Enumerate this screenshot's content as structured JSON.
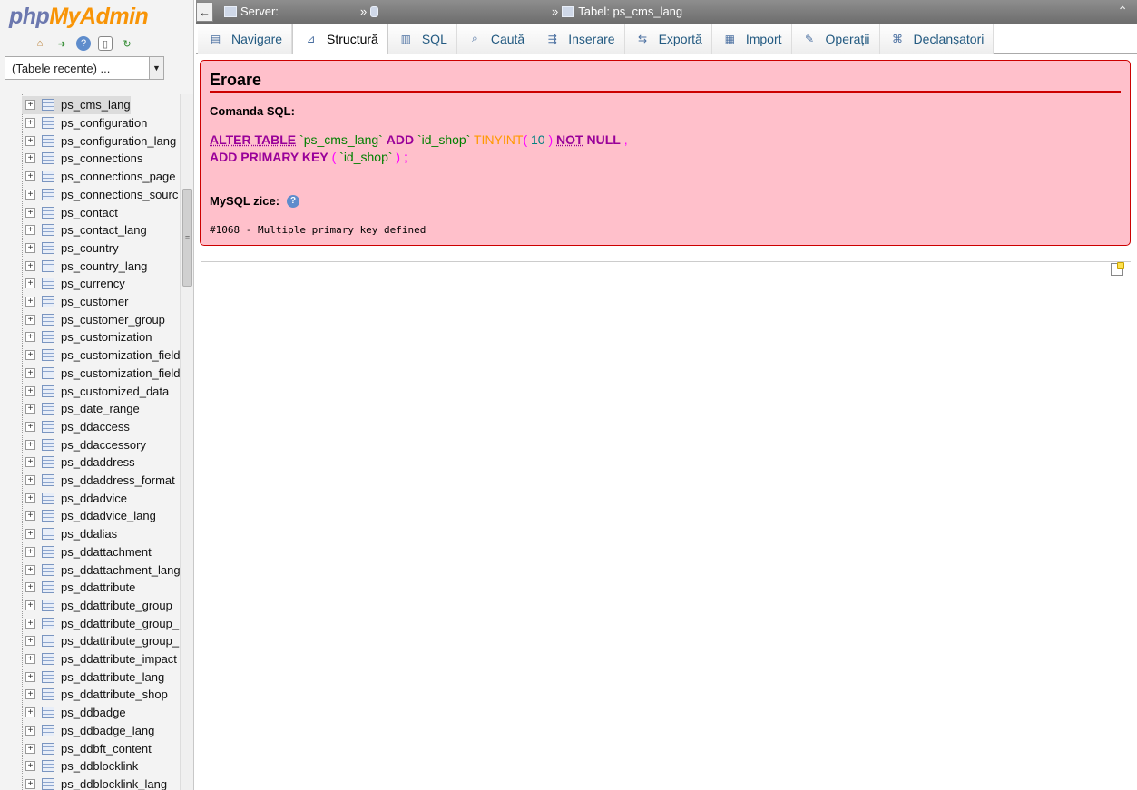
{
  "logo": {
    "php": "php",
    "myadmin": "MyAdmin"
  },
  "nav_icons": [
    "home-icon",
    "logout-icon",
    "help-icon",
    "docs-icon",
    "reload-icon"
  ],
  "recent_tables": {
    "value": "(Tabele recente) ..."
  },
  "tree": {
    "items": [
      "ps_cms_lang",
      "ps_configuration",
      "ps_configuration_lang",
      "ps_connections",
      "ps_connections_page",
      "ps_connections_sourc",
      "ps_contact",
      "ps_contact_lang",
      "ps_country",
      "ps_country_lang",
      "ps_currency",
      "ps_customer",
      "ps_customer_group",
      "ps_customization",
      "ps_customization_field",
      "ps_customization_field",
      "ps_customized_data",
      "ps_date_range",
      "ps_ddaccess",
      "ps_ddaccessory",
      "ps_ddaddress",
      "ps_ddaddress_format",
      "ps_ddadvice",
      "ps_ddadvice_lang",
      "ps_ddalias",
      "ps_ddattachment",
      "ps_ddattachment_lang",
      "ps_ddattribute",
      "ps_ddattribute_group",
      "ps_ddattribute_group_",
      "ps_ddattribute_group_",
      "ps_ddattribute_impact",
      "ps_ddattribute_lang",
      "ps_ddattribute_shop",
      "ps_ddbadge",
      "ps_ddbadge_lang",
      "ps_ddbft_content",
      "ps_ddblocklink",
      "ps_ddblocklink_lang"
    ],
    "active_index": 0
  },
  "breadcrumb": {
    "back": "←",
    "server_label": "Server:",
    "sep": "»",
    "table_label": "Tabel: ps_cms_lang"
  },
  "tabs": [
    {
      "label": "Navigare",
      "icon": "browse-icon",
      "glyph": "▤"
    },
    {
      "label": "Structură",
      "icon": "structure-icon",
      "glyph": "⊿"
    },
    {
      "label": "SQL",
      "icon": "sql-icon",
      "glyph": "▥"
    },
    {
      "label": "Caută",
      "icon": "search-icon",
      "glyph": "⌕"
    },
    {
      "label": "Inserare",
      "icon": "insert-icon",
      "glyph": "⇶"
    },
    {
      "label": "Exportă",
      "icon": "export-icon",
      "glyph": "⇆"
    },
    {
      "label": "Import",
      "icon": "import-icon",
      "glyph": "▦"
    },
    {
      "label": "Operații",
      "icon": "wrench-icon",
      "glyph": "✎"
    },
    {
      "label": "Declanșatori",
      "icon": "triggers-icon",
      "glyph": "⌘"
    }
  ],
  "active_tab": 1,
  "error": {
    "title": "Eroare",
    "sql_label": "Comanda SQL:",
    "sql": {
      "alter_table": "ALTER TABLE",
      "table": "`ps_cms_lang`",
      "add": "ADD",
      "column": "`id_shop`",
      "type": "TINYINT",
      "open": "(",
      "size": "10",
      "close": ")",
      "not": "NOT",
      "null": "NULL",
      "comma": ",",
      "add2": "ADD",
      "primary_key": "PRIMARY KEY",
      "open2": "(",
      "column2": "`id_shop`",
      "close2": ") ;"
    },
    "mysql_says": "MySQL zice:",
    "message": "#1068 - Multiple primary key defined"
  },
  "colors": {
    "error_bg": "#ffc0cb",
    "error_border": "#cc0000",
    "link": "#235a81"
  }
}
